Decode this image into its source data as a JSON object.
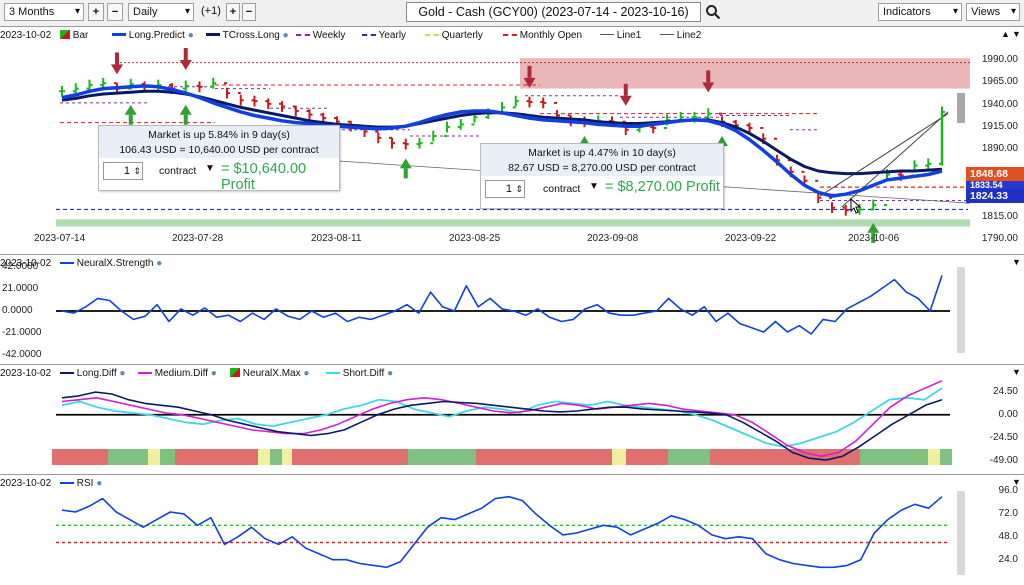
{
  "toolbar": {
    "period": "3 Months",
    "interval": "Daily",
    "offset": "(+1)",
    "title": "Gold - Cash (GCY00) (2023-07-14 - 2023-10-16)",
    "indicators": "Indicators",
    "views": "Views"
  },
  "price": {
    "date_label": "2023-10-02",
    "legend": [
      "Bar",
      "Long.Predict",
      "TCross.Long",
      "Weekly",
      "Yearly",
      "Quarterly",
      "Monthly Open",
      "Line1",
      "Line2"
    ],
    "y_ticks": [
      "1990.00",
      "1965.00",
      "1940.00",
      "1915.00",
      "1890.00",
      "1865.00",
      "1840.00",
      "1815.00",
      "1790.00"
    ],
    "x_labels": [
      "2023-07-14",
      "2023-07-28",
      "2023-08-11",
      "2023-08-25",
      "2023-09-08",
      "2023-09-22",
      "2023-10-06"
    ],
    "price_tags": [
      "1848.68",
      "1833.54",
      "1824.33"
    ],
    "box1": {
      "line1": "Market is up 5.84% in 9 day(s)",
      "line2": "106.43 USD = 10,640.00 USD per contract",
      "qty": "1",
      "contract": "contract",
      "profit": "= $10,640.00 Profit"
    },
    "box2": {
      "line1": "Market is up 4.47% in 10 day(s)",
      "line2": "82.67 USD = 8,270.00 USD per contract",
      "qty": "1",
      "contract": "contract",
      "profit": "= $8,270.00 Profit"
    }
  },
  "strength": {
    "date_label": "2023-10-02",
    "legend": [
      "NeuralX.Strength"
    ],
    "y_ticks": [
      "42.0000",
      "21.0000",
      "0.0000",
      "-21.0000",
      "-42.0000"
    ]
  },
  "diff": {
    "date_label": "2023-10-02",
    "legend": [
      "Long.Diff",
      "Medium.Diff",
      "NeuralX.Max",
      "Short.Diff"
    ],
    "y_ticks": [
      "24.50",
      "0.00",
      "-24.50",
      "-49.00"
    ]
  },
  "rsi": {
    "date_label": "2023-10-02",
    "legend": [
      "RSI"
    ],
    "y_ticks": [
      "96.0",
      "72.0",
      "48.0",
      "24.0"
    ]
  },
  "colors": {
    "bull": "#18b818",
    "bear": "#c81818",
    "long_predict": "#1040e0",
    "tcross": "#0a1a60",
    "cyan": "#40d8e0",
    "magenta": "#d020d0",
    "rsi_green": "#20c820",
    "rsi_red": "#e02020"
  },
  "chart_data": [
    {
      "type": "line",
      "title": "Gold - Cash (GCY00) (2023-07-14 - 2023-10-16)",
      "x": [
        "2023-07-14",
        "2023-07-17",
        "2023-07-18",
        "2023-07-19",
        "2023-07-20",
        "2023-07-21",
        "2023-07-24",
        "2023-07-25",
        "2023-07-26",
        "2023-07-27",
        "2023-07-28",
        "2023-07-31",
        "2023-08-01",
        "2023-08-02",
        "2023-08-03",
        "2023-08-04",
        "2023-08-07",
        "2023-08-08",
        "2023-08-09",
        "2023-08-10",
        "2023-08-11",
        "2023-08-14",
        "2023-08-15",
        "2023-08-16",
        "2023-08-17",
        "2023-08-18",
        "2023-08-21",
        "2023-08-22",
        "2023-08-23",
        "2023-08-24",
        "2023-08-25",
        "2023-08-28",
        "2023-08-29",
        "2023-08-30",
        "2023-08-31",
        "2023-09-01",
        "2023-09-05",
        "2023-09-06",
        "2023-09-07",
        "2023-09-08",
        "2023-09-11",
        "2023-09-12",
        "2023-09-13",
        "2023-09-14",
        "2023-09-15",
        "2023-09-18",
        "2023-09-19",
        "2023-09-20",
        "2023-09-21",
        "2023-09-22",
        "2023-09-25",
        "2023-09-26",
        "2023-09-27",
        "2023-09-28",
        "2023-09-29",
        "2023-10-02",
        "2023-10-03",
        "2023-10-04",
        "2023-10-05",
        "2023-10-06",
        "2023-10-09",
        "2023-10-10",
        "2023-10-11",
        "2023-10-12",
        "2023-10-13"
      ],
      "series": [
        {
          "name": "Bar",
          "values": [
            1955,
            1958,
            1962,
            1964,
            1958,
            1963,
            1960,
            1962,
            1958,
            1961,
            1960,
            1964,
            1953,
            1945,
            1944,
            1941,
            1938,
            1933,
            1929,
            1925,
            1921,
            1916,
            1910,
            1903,
            1897,
            1896,
            1897,
            1905,
            1915,
            1918,
            1926,
            1930,
            1937,
            1944,
            1943,
            1942,
            1928,
            1922,
            1921,
            1922,
            1921,
            1912,
            1915,
            1914,
            1923,
            1926,
            1926,
            1930,
            1921,
            1917,
            1914,
            1902,
            1878,
            1865,
            1855,
            1836,
            1825,
            1822,
            1823,
            1828,
            1862,
            1861,
            1872,
            1874,
            1932
          ]
        },
        {
          "name": "Long.Predict",
          "values": [
            1948,
            1951,
            1955,
            1958,
            1959,
            1960,
            1961,
            1960,
            1957,
            1953,
            1948,
            1942,
            1937,
            1932,
            1928,
            1925,
            1922,
            1920,
            1919,
            1917,
            1916,
            1915,
            1914,
            1913,
            1914,
            1916,
            1920,
            1925,
            1929,
            1932,
            1933,
            1933,
            1931,
            1928,
            1925,
            1923,
            1922,
            1921,
            1920,
            1918,
            1917,
            1916,
            1916,
            1918,
            1920,
            1922,
            1923,
            1922,
            1918,
            1911,
            1901,
            1889,
            1876,
            1862,
            1850,
            1842,
            1838,
            1840,
            1844,
            1850,
            1856,
            1858,
            1860,
            1862,
            1866
          ]
        },
        {
          "name": "TCross.Long",
          "values": [
            1945,
            1947,
            1950,
            1952,
            1953,
            1954,
            1955,
            1955,
            1954,
            1952,
            1949,
            1945,
            1941,
            1937,
            1934,
            1931,
            1928,
            1925,
            1922,
            1920,
            1918,
            1917,
            1916,
            1915,
            1915,
            1916,
            1919,
            1922,
            1925,
            1928,
            1930,
            1931,
            1931,
            1930,
            1928,
            1926,
            1925,
            1924,
            1923,
            1921,
            1920,
            1919,
            1919,
            1920,
            1921,
            1922,
            1923,
            1923,
            1920,
            1915,
            1908,
            1899,
            1889,
            1879,
            1871,
            1866,
            1864,
            1863,
            1863,
            1864,
            1865,
            1866,
            1866,
            1867,
            1868
          ]
        }
      ],
      "ylim": [
        1790,
        2000
      ]
    },
    {
      "type": "line",
      "x": [
        "2023-07-14",
        "2023-07-17",
        "2023-07-18",
        "2023-07-19",
        "2023-07-20",
        "2023-07-21",
        "2023-07-24",
        "2023-07-25",
        "2023-07-26",
        "2023-07-27",
        "2023-07-28",
        "2023-07-31",
        "2023-08-01",
        "2023-08-02",
        "2023-08-03",
        "2023-08-04",
        "2023-08-07",
        "2023-08-08",
        "2023-08-09",
        "2023-08-10",
        "2023-08-11",
        "2023-08-14",
        "2023-08-15",
        "2023-08-16",
        "2023-08-17",
        "2023-08-18",
        "2023-08-21",
        "2023-08-22",
        "2023-08-23",
        "2023-08-24",
        "2023-08-25",
        "2023-08-28",
        "2023-08-29",
        "2023-08-30",
        "2023-08-31",
        "2023-09-01",
        "2023-09-05",
        "2023-09-06",
        "2023-09-07",
        "2023-09-08",
        "2023-09-11",
        "2023-09-12",
        "2023-09-13",
        "2023-09-14",
        "2023-09-15",
        "2023-09-18",
        "2023-09-19",
        "2023-09-20",
        "2023-09-21",
        "2023-09-22",
        "2023-09-25",
        "2023-09-26",
        "2023-09-27",
        "2023-09-28",
        "2023-09-29",
        "2023-10-02",
        "2023-10-03",
        "2023-10-04",
        "2023-10-05",
        "2023-10-06",
        "2023-10-09",
        "2023-10-10",
        "2023-10-11",
        "2023-10-12",
        "2023-10-13"
      ],
      "series": [
        {
          "name": "NeuralX.Strength",
          "values": [
            0,
            -2,
            4,
            12,
            10,
            0,
            -8,
            -5,
            6,
            -10,
            2,
            -4,
            3,
            -6,
            -4,
            -10,
            -2,
            -8,
            2,
            -5,
            -8,
            0,
            -6,
            -2,
            -10,
            -6,
            -8,
            -4,
            0,
            6,
            -2,
            18,
            4,
            0,
            24,
            4,
            12,
            2,
            0,
            -4,
            2,
            -6,
            -10,
            -8,
            2,
            6,
            -2,
            -4,
            -4,
            -2,
            0,
            12,
            2,
            -4,
            4,
            -10,
            -2,
            -12,
            -16,
            -20,
            -10,
            -20,
            -14,
            -22,
            -8,
            -10,
            2,
            8,
            14,
            22,
            30,
            18,
            12,
            0,
            34
          ]
        }
      ],
      "ylim": [
        -42,
        42
      ]
    },
    {
      "type": "line",
      "x": [
        "2023-07-14",
        "2023-07-17",
        "2023-07-18",
        "2023-07-19",
        "2023-07-20",
        "2023-07-21",
        "2023-07-24",
        "2023-07-25",
        "2023-07-26",
        "2023-07-27",
        "2023-07-28",
        "2023-07-31",
        "2023-08-01",
        "2023-08-02",
        "2023-08-03",
        "2023-08-04",
        "2023-08-07",
        "2023-08-08",
        "2023-08-09",
        "2023-08-10",
        "2023-08-11",
        "2023-08-14",
        "2023-08-15",
        "2023-08-16",
        "2023-08-17",
        "2023-08-18",
        "2023-08-21",
        "2023-08-22",
        "2023-08-23",
        "2023-08-24",
        "2023-08-25",
        "2023-08-28",
        "2023-08-29",
        "2023-08-30",
        "2023-08-31",
        "2023-09-01",
        "2023-09-05",
        "2023-09-06",
        "2023-09-07",
        "2023-09-08",
        "2023-09-11",
        "2023-09-12",
        "2023-09-13",
        "2023-09-14",
        "2023-09-15",
        "2023-09-18",
        "2023-09-19",
        "2023-09-20",
        "2023-09-21",
        "2023-09-22",
        "2023-09-25",
        "2023-09-26",
        "2023-09-27",
        "2023-09-28",
        "2023-09-29",
        "2023-10-02",
        "2023-10-03",
        "2023-10-04",
        "2023-10-05",
        "2023-10-06",
        "2023-10-09",
        "2023-10-10",
        "2023-10-11",
        "2023-10-12",
        "2023-10-13"
      ],
      "series": [
        {
          "name": "Long.Diff",
          "values": [
            18,
            20,
            24,
            22,
            16,
            12,
            10,
            8,
            4,
            0,
            -6,
            -10,
            -14,
            -18,
            -20,
            -22,
            -20,
            -16,
            -8,
            0,
            6,
            10,
            12,
            14,
            13,
            12,
            10,
            8,
            6,
            4,
            3,
            4,
            6,
            8,
            8,
            6,
            5,
            4,
            3,
            2,
            0,
            -8,
            -18,
            -28,
            -40,
            -46,
            -48,
            -44,
            -34,
            -22,
            -10,
            0,
            10,
            16
          ]
        },
        {
          "name": "Medium.Diff",
          "values": [
            14,
            16,
            18,
            14,
            10,
            6,
            2,
            0,
            -4,
            -8,
            -12,
            -16,
            -18,
            -20,
            -20,
            -16,
            -10,
            -2,
            6,
            12,
            16,
            18,
            16,
            12,
            8,
            4,
            2,
            4,
            8,
            12,
            10,
            6,
            8,
            10,
            12,
            10,
            6,
            4,
            2,
            0,
            -8,
            -20,
            -32,
            -40,
            -44,
            -40,
            -28,
            -10,
            8,
            20,
            28,
            36
          ]
        },
        {
          "name": "Short.Diff",
          "values": [
            10,
            14,
            8,
            4,
            2,
            0,
            -4,
            -8,
            -10,
            -6,
            -4,
            -10,
            -12,
            -8,
            -4,
            0,
            6,
            10,
            16,
            14,
            6,
            2,
            -2,
            4,
            8,
            6,
            2,
            10,
            14,
            12,
            10,
            14,
            10,
            8,
            6,
            4,
            0,
            -6,
            -14,
            -22,
            -30,
            -34,
            -30,
            -24,
            -18,
            -8,
            4,
            16,
            18,
            16,
            28
          ]
        }
      ],
      "ylim": [
        -49,
        40
      ]
    },
    {
      "type": "line",
      "x": [
        "2023-07-14",
        "2023-07-17",
        "2023-07-18",
        "2023-07-19",
        "2023-07-20",
        "2023-07-21",
        "2023-07-24",
        "2023-07-25",
        "2023-07-26",
        "2023-07-27",
        "2023-07-28",
        "2023-07-31",
        "2023-08-01",
        "2023-08-02",
        "2023-08-03",
        "2023-08-04",
        "2023-08-07",
        "2023-08-08",
        "2023-08-09",
        "2023-08-10",
        "2023-08-11",
        "2023-08-14",
        "2023-08-15",
        "2023-08-16",
        "2023-08-17",
        "2023-08-18",
        "2023-08-21",
        "2023-08-22",
        "2023-08-23",
        "2023-08-24",
        "2023-08-25",
        "2023-08-28",
        "2023-08-29",
        "2023-08-30",
        "2023-08-31",
        "2023-09-01",
        "2023-09-05",
        "2023-09-06",
        "2023-09-07",
        "2023-09-08",
        "2023-09-11",
        "2023-09-12",
        "2023-09-13",
        "2023-09-14",
        "2023-09-15",
        "2023-09-18",
        "2023-09-19",
        "2023-09-20",
        "2023-09-21",
        "2023-09-22",
        "2023-09-25",
        "2023-09-26",
        "2023-09-27",
        "2023-09-28",
        "2023-09-29",
        "2023-10-02",
        "2023-10-03",
        "2023-10-04",
        "2023-10-05",
        "2023-10-06",
        "2023-10-09",
        "2023-10-10",
        "2023-10-11",
        "2023-10-12",
        "2023-10-13"
      ],
      "series": [
        {
          "name": "RSI",
          "values": [
            76,
            74,
            80,
            88,
            74,
            66,
            58,
            66,
            74,
            72,
            60,
            68,
            40,
            48,
            58,
            46,
            40,
            48,
            36,
            30,
            24,
            24,
            20,
            18,
            16,
            22,
            40,
            58,
            68,
            66,
            72,
            78,
            88,
            90,
            86,
            72,
            60,
            50,
            52,
            56,
            60,
            58,
            50,
            56,
            62,
            70,
            66,
            60,
            50,
            46,
            48,
            46,
            30,
            24,
            20,
            18,
            16,
            16,
            18,
            24,
            52,
            66,
            76,
            82,
            78,
            90
          ]
        }
      ],
      "ylim": [
        10,
        96
      ],
      "reference_lines": [
        60,
        42
      ]
    }
  ]
}
